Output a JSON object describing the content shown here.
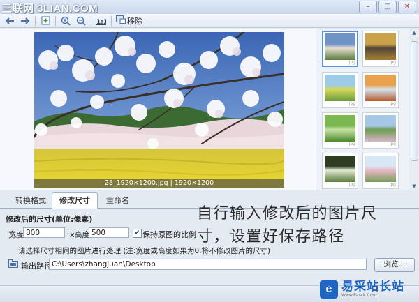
{
  "titlebar": {
    "watermark": "三联网 3LIAN.COM",
    "controls": [
      "–",
      "□",
      "✕"
    ]
  },
  "toolbar": {
    "remove_label": "移除"
  },
  "preview": {
    "caption": "28_1920×1200.jpg | 1920×1200"
  },
  "thumbnails": [
    {
      "tag": "jpg",
      "palette": [
        "#6f93c7",
        "#e7dcd0",
        "#5b7d3c"
      ]
    },
    {
      "tag": "jpg",
      "palette": [
        "#caa24a",
        "#53463a",
        "#a4822f"
      ]
    },
    {
      "tag": "jpg",
      "palette": [
        "#9ecbe6",
        "#d5d95b",
        "#6a9b3d"
      ]
    },
    {
      "tag": "jpg",
      "palette": [
        "#e8a14d",
        "#d3e4ef",
        "#b55a2f"
      ]
    },
    {
      "tag": "jpg",
      "palette": [
        "#7cb852",
        "#c8e2a4",
        "#4a8a2c"
      ]
    },
    {
      "tag": "jpg",
      "palette": [
        "#a6c7e6",
        "#6d9c51",
        "#d6b6c6"
      ]
    },
    {
      "tag": "jpg",
      "palette": [
        "#2e3d22",
        "#dfe9d2",
        "#5b7a3a"
      ]
    },
    {
      "tag": "jpg",
      "palette": [
        "#d7e7f3",
        "#e8b8c4",
        "#789d5a"
      ]
    }
  ],
  "tabs": [
    {
      "label": "转换格式",
      "active": false
    },
    {
      "label": "修改尺寸",
      "active": true
    },
    {
      "label": "重命名",
      "active": false
    }
  ],
  "resize": {
    "section_title": "修改后的尺寸(单位:像素)",
    "width_label": "宽度",
    "width_value": "800",
    "height_label": "x高度",
    "height_value": "500",
    "keep_ratio_label": "保持原图的比例",
    "keep_ratio_checked": true,
    "hint": "请选择尺寸相同的图片进行处理 (注:宽度或高度如果为0,将不修改图片的尺寸)"
  },
  "output": {
    "label": "输出路径",
    "path": "C:\\Users\\zhangjuan\\Desktop",
    "browse_label": "浏览..."
  },
  "annotation": "自行输入修改后的图片尺寸，设置好保存路径",
  "logo": {
    "icon_letter": "e",
    "name": "易采站长站",
    "tagline": "Www.Easck.Com"
  },
  "colors": {
    "accent": "#1d67c2",
    "window_bg": "#e4eaf2"
  }
}
